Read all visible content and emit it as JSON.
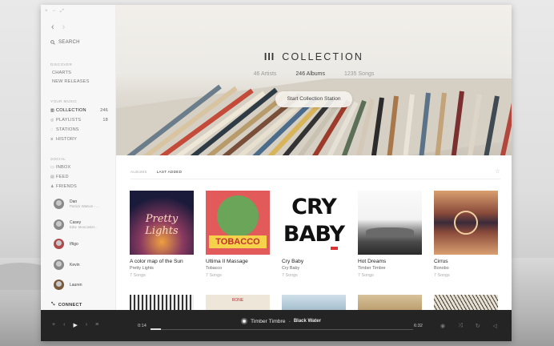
{
  "window": {
    "controls": [
      "×",
      "−",
      "⤢"
    ]
  },
  "nav": {
    "back": "‹",
    "forward": "›"
  },
  "search": {
    "label": "SEARCH"
  },
  "discover": {
    "title": "DISCOVER",
    "items": [
      {
        "label": "CHARTS"
      },
      {
        "label": "NEW RELEASES"
      }
    ]
  },
  "your_music": {
    "title": "YOUR MUSIC",
    "items": [
      {
        "label": "COLLECTION",
        "count": "246",
        "icon": "collection-icon"
      },
      {
        "label": "PLAYLISTS",
        "count": "18",
        "icon": "playlists-icon"
      },
      {
        "label": "STATIONS",
        "count": "",
        "icon": "stations-icon"
      },
      {
        "label": "HISTORY",
        "count": "",
        "icon": "history-icon"
      }
    ]
  },
  "social": {
    "title": "SOCIAL",
    "items": [
      {
        "label": "INBOX",
        "icon": "inbox-icon"
      },
      {
        "label": "FEED",
        "icon": "feed-icon"
      },
      {
        "label": "FRIENDS",
        "icon": "friends-icon"
      }
    ],
    "friends": [
      {
        "name": "Dan",
        "status": "Patrick Watson - ..."
      },
      {
        "name": "Casey",
        "status": "Edw. Moncaster..."
      },
      {
        "name": "Iñigo",
        "status": ""
      },
      {
        "name": "Kevin",
        "status": ""
      },
      {
        "name": "Lauren",
        "status": ""
      }
    ],
    "connect": "CONNECT"
  },
  "hero": {
    "title": "COLLECTION",
    "stats": [
      "46 Artists",
      "246 Albums",
      "1235 Songs"
    ],
    "button": "Start Collection Station"
  },
  "tabs": [
    "ALBUMS",
    "LAST ADDED"
  ],
  "albums": [
    {
      "title": "A color map of the Sun",
      "artist": "Pretty Lights",
      "songs": "7 Songs",
      "cover_text": "Pretty Lights"
    },
    {
      "title": "Ultima II Massage",
      "artist": "Tobacco",
      "songs": "7 Songs",
      "cover_text": "TOBACCO"
    },
    {
      "title": "Cry Baby",
      "artist": "Cry Baby",
      "songs": "7 Songs",
      "cover_text": "CRY BABY"
    },
    {
      "title": "Hot Dreams",
      "artist": "Timber Timbre",
      "songs": "7 Songs",
      "cover_text": ""
    },
    {
      "title": "Cirrus",
      "artist": "Bonobo",
      "songs": "7 Songs",
      "cover_text": ""
    }
  ],
  "player": {
    "current_time": "0:14",
    "duration": "6:32",
    "artist": "Timber Timbre",
    "track": "Black Water",
    "progress": 0.04
  }
}
